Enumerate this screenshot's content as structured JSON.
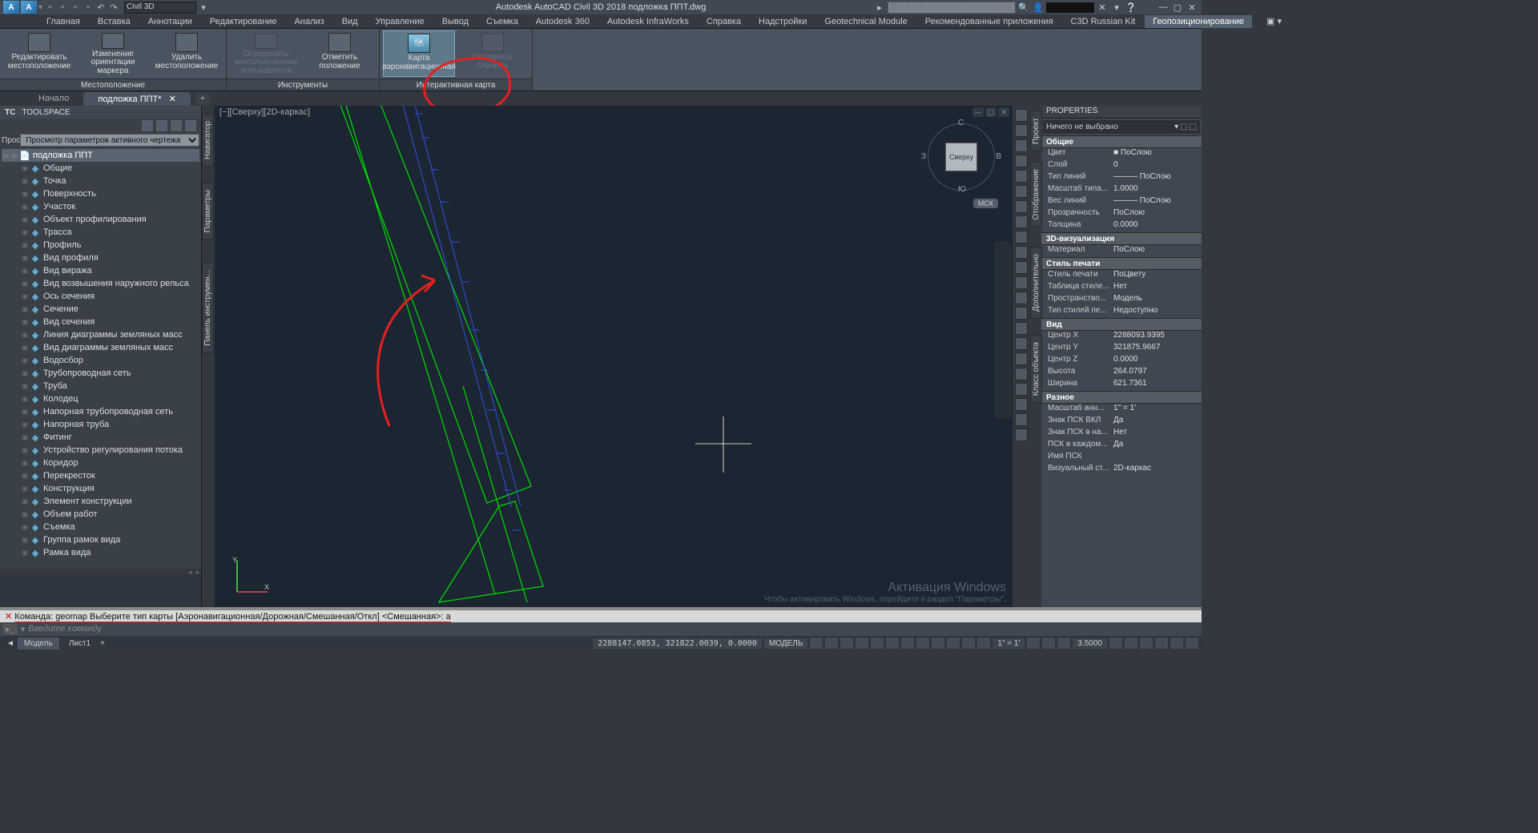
{
  "app_title": "Autodesk AutoCAD Civil 3D 2018   подложка ППТ.dwg",
  "workspace": "Civil 3D",
  "search_placeholder": "Введите ключевое слово/фразу",
  "ribbon_tabs": [
    "Главная",
    "Вставка",
    "Аннотации",
    "Редактирование",
    "Анализ",
    "Вид",
    "Управление",
    "Вывод",
    "Съемка",
    "Autodesk 360",
    "Autodesk InfraWorks",
    "Справка",
    "Надстройки",
    "Geotechnical Module",
    "Рекомендованные приложения",
    "C3D Russian Kit",
    "Геопозиционирование"
  ],
  "active_ribbon_tab": 16,
  "ribbon_panels": [
    {
      "label": "Местоположение",
      "buttons": [
        {
          "label": "Редактировать местоположение",
          "disabled": false
        },
        {
          "label": "Изменение ориентации маркера",
          "disabled": false
        },
        {
          "label": "Удалить местоположение",
          "disabled": false
        }
      ]
    },
    {
      "label": "Инструменты",
      "buttons": [
        {
          "label": "Определить местоположение пользователя",
          "disabled": true
        },
        {
          "label": "Отметить положение",
          "disabled": false
        }
      ]
    },
    {
      "label": "Интерактивная карта",
      "buttons": [
        {
          "label": "Карта аэронавигационная",
          "disabled": false,
          "highlight": true
        },
        {
          "label": "Сохранить Область",
          "disabled": true
        }
      ]
    }
  ],
  "doc_tabs": [
    {
      "label": "Начало",
      "active": false
    },
    {
      "label": "подложка ППТ*",
      "active": true
    }
  ],
  "toolspace": {
    "header": "TOOLSPACE",
    "tc_label": "ТС",
    "selector": "Просмотр параметров активного чертежа",
    "root": "подложка ППТ",
    "items": [
      "Общие",
      "Точка",
      "Поверхность",
      "Участок",
      "Объект профилирования",
      "Трасса",
      "Профиль",
      "Вид профиля",
      "Вид виража",
      "Вид возвышения наружного рельса",
      "Ось сечения",
      "Сечение",
      "Вид сечения",
      "Линия диаграммы земляных масс",
      "Вид диаграммы земляных масс",
      "Водосбор",
      "Трубопроводная сеть",
      "Труба",
      "Колодец",
      "Напорная трубопроводная сеть",
      "Напорная труба",
      "Фитинг",
      "Устройство регулирования потока",
      "Коридор",
      "Перекресток",
      "Конструкция",
      "Элемент конструкции",
      "Объем работ",
      "Съемка",
      "Группа рамок вида",
      "Рамка вида"
    ]
  },
  "side_palettes": [
    "Навигатор",
    "Параметры",
    "Панель инструмен..."
  ],
  "prop_side_tabs": [
    "Проект",
    "Отображение",
    "Дополнительно",
    "Класс объекта"
  ],
  "viewport_label": "[−][Сверху][2D-каркас]",
  "viewcube": {
    "face": "Сверху",
    "n": "С",
    "s": "Ю",
    "e": "В",
    "w": "З",
    "ucs": "МСК"
  },
  "properties": {
    "title": "PROPERTIES",
    "selection": "Ничего не выбрано",
    "sections": [
      {
        "title": "Общие",
        "rows": [
          {
            "k": "Цвет",
            "v": "■ ПоСлою"
          },
          {
            "k": "Слой",
            "v": "0"
          },
          {
            "k": "Тип линий",
            "v": "——— ПоСлою"
          },
          {
            "k": "Масштаб типа...",
            "v": "1.0000"
          },
          {
            "k": "Вес линий",
            "v": "——— ПоСлою"
          },
          {
            "k": "Прозрачность",
            "v": "ПоСлою"
          },
          {
            "k": "Толщина",
            "v": "0.0000"
          }
        ]
      },
      {
        "title": "3D-визуализация",
        "rows": [
          {
            "k": "Материал",
            "v": "ПоСлою"
          }
        ]
      },
      {
        "title": "Стиль печати",
        "rows": [
          {
            "k": "Стиль печати",
            "v": "ПоЦвету"
          },
          {
            "k": "Таблица стиле...",
            "v": "Нет"
          },
          {
            "k": "Пространство...",
            "v": "Модель"
          },
          {
            "k": "Тип стилей пе...",
            "v": "Недоступно"
          }
        ]
      },
      {
        "title": "Вид",
        "rows": [
          {
            "k": "Центр X",
            "v": "2288093.9395"
          },
          {
            "k": "Центр Y",
            "v": "321875.9667"
          },
          {
            "k": "Центр Z",
            "v": "0.0000"
          },
          {
            "k": "Высота",
            "v": "264.0797"
          },
          {
            "k": "Ширина",
            "v": "621.7361"
          }
        ]
      },
      {
        "title": "Разное",
        "rows": [
          {
            "k": "Масштаб анн...",
            "v": "1\" = 1'"
          },
          {
            "k": "Знак ПСК ВКЛ",
            "v": "Да"
          },
          {
            "k": "Знак ПСК в на...",
            "v": "Нет"
          },
          {
            "k": "ПСК в каждом...",
            "v": "Да"
          },
          {
            "k": "Имя ПСК",
            "v": ""
          },
          {
            "k": "Визуальный ст...",
            "v": "2D-каркас"
          }
        ]
      }
    ]
  },
  "command": {
    "line": "Команда:  geomap Выберите тип карты [Аэронавигационная/Дорожная/Смешанная/Откл] <Смешанная>:  а",
    "input_placeholder": "Введите команду"
  },
  "status": {
    "model_tab": "Модель",
    "layout_tab": "Лист1",
    "coords": "2288147.0853, 321822.0039, 0.0000",
    "space": "МОДЕЛЬ",
    "scale": "1\" = 1'",
    "decimal": "3.5000"
  },
  "watermark": {
    "line1": "Активация Windows",
    "line2": "Чтобы активировать Windows, перейдите в раздел \"Параметры\"."
  }
}
